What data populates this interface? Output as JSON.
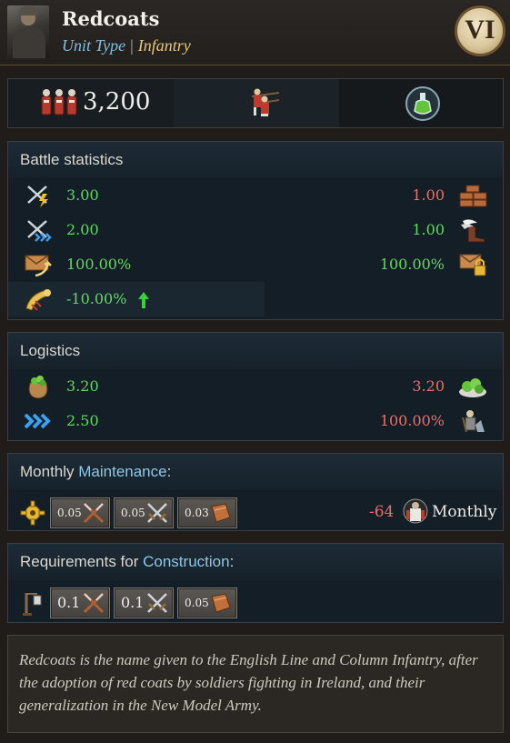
{
  "header": {
    "title": "Redcoats",
    "unit_type_label": "Unit Type",
    "separator": "|",
    "unit_type_value": "Infantry",
    "tier": "VI"
  },
  "summary": {
    "men": "3,200"
  },
  "battle": {
    "heading": "Battle statistics",
    "rows": [
      {
        "left": "3.00",
        "right": "1.00",
        "right_color": "#e8706a"
      },
      {
        "left": "2.00",
        "right": "1.00",
        "right_color": "#63d763"
      },
      {
        "left": "100.00%",
        "right": "100.00%",
        "right_color": "#63d763"
      },
      {
        "left": "-10.00%",
        "right": ""
      }
    ]
  },
  "logistics": {
    "heading": "Logistics",
    "rows": [
      {
        "left": "3.20",
        "right": "3.20",
        "right_color": "#e8706a"
      },
      {
        "left": "2.50",
        "right": "100.00%",
        "right_color": "#e8706a"
      }
    ]
  },
  "maintenance": {
    "heading_prefix": "Monthly ",
    "heading_highlight": "Maintenance",
    "heading_suffix": ":",
    "chips": [
      "0.05",
      "0.05",
      "0.03"
    ],
    "manpower": "-64",
    "period": "Monthly"
  },
  "construction": {
    "heading_prefix": "Requirements for ",
    "heading_highlight": "Construction",
    "heading_suffix": ":",
    "chips": [
      "0.1",
      "0.1",
      "0.05"
    ]
  },
  "description": "Redcoats is the name given to the English Line and Column Infantry, after the adoption of red coats by soldiers fighting in Ireland, and their generalization in the New Model Army.",
  "colors": {
    "positive": "#63d763",
    "negative": "#e8706a",
    "accent_blue": "#8cc8e8",
    "gold": "#e8c87a"
  },
  "icons": {
    "summary": [
      "regiment-icon",
      "musketeers-icon",
      "potion-icon"
    ],
    "battle": [
      "melee-attack-icon",
      "defense-bricks-icon",
      "ranged-attack-icon",
      "boot-speed-icon",
      "morale-envelope-icon",
      "morale-lock-icon",
      "horn-icon",
      "up-arrow-icon"
    ],
    "logistics": [
      "food-sack-icon",
      "green-food-icon",
      "movement-chevrons-icon",
      "supply-soldier-icon"
    ],
    "costs": [
      "gold-gear-icon",
      "crossed-muskets-icon",
      "crossed-swords-icon",
      "leather-icon",
      "lamp-post-icon",
      "manpower-icon"
    ]
  }
}
